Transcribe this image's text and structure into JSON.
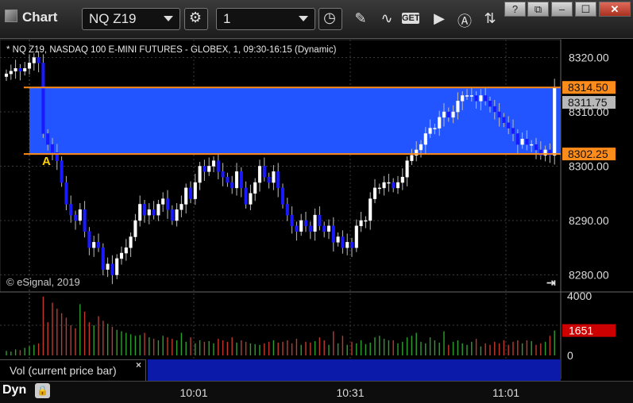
{
  "window": {
    "title": "Chart",
    "symbol": "NQ Z19",
    "interval": "1",
    "toolbar_icons": [
      "settings-gear-icon",
      "clock-icon",
      "pencil-icon",
      "study-icon",
      "get-icon",
      "play-icon",
      "alert-icon",
      "sync-icon"
    ],
    "window_controls": [
      "help-icon",
      "restore-icon",
      "minimize-icon",
      "maximize-icon",
      "close-icon"
    ],
    "help_label": "?",
    "get_label": "GET"
  },
  "chart": {
    "description": "* NQ Z19, NASDAQ 100 E-MINI FUTURES - GLOBEX, 1, 09:30-16:15 (Dynamic)",
    "copyright": "© eSignal, 2019",
    "marker_label": "A",
    "panel_label": "Vol (current price bar)",
    "bottom_mode": "Dyn",
    "colors": {
      "band": "#2255ff",
      "levels": "#ff8c1a",
      "up": "#ffffff",
      "down": "#1a1aff",
      "vol_up": "#2ca02c",
      "vol_down": "#c0392b",
      "vol_label": "#cc0000"
    }
  },
  "chart_data": {
    "type": "candlestick",
    "price_axis": {
      "ylim": [
        8277,
        8323
      ],
      "ticks": [
        "8320.00",
        "8310.00",
        "8300.00",
        "8290.00",
        "8280.00"
      ]
    },
    "volume_axis": {
      "ylim": [
        0,
        4000
      ],
      "ticks": [
        "4000",
        "0"
      ]
    },
    "time_ticks": [
      "10:01",
      "10:31",
      "11:01"
    ],
    "levels": [
      {
        "label": "8314.50",
        "value": 8314.5,
        "style": "orange"
      },
      {
        "label": "8311.75",
        "value": 8311.75,
        "style": "gray"
      },
      {
        "label": "8302.25",
        "value": 8302.25,
        "style": "orange"
      }
    ],
    "band": [
      8302.25,
      8314.5
    ],
    "volume_label": {
      "label": "1651",
      "value": 1651
    },
    "closes": [
      8317,
      8317.5,
      8318,
      8317.5,
      8318,
      8319,
      8320,
      8319,
      8306,
      8304,
      8302.5,
      8301,
      8297,
      8293,
      8291,
      8290,
      8292,
      8288,
      8285,
      8286,
      8285,
      8281,
      8282,
      8280,
      8283,
      8284,
      8285,
      8287,
      8290,
      8293,
      8291,
      8292,
      8291,
      8293,
      8294,
      8292,
      8290,
      8292,
      8293,
      8296,
      8294,
      8297,
      8300,
      8299,
      8300,
      8301,
      8299,
      8298,
      8297,
      8296,
      8299,
      8296,
      8293,
      8295,
      8297,
      8300,
      8298,
      8297,
      8299,
      8296,
      8293,
      8291,
      8289,
      8288,
      8290,
      8289,
      8288,
      8291,
      8289,
      8288,
      8289,
      8286,
      8287,
      8285,
      8286,
      8285,
      8289,
      8290,
      8290,
      8294,
      8296,
      8296,
      8297,
      8297,
      8296,
      8297,
      8298,
      8301,
      8302,
      8303,
      8304,
      8306,
      8307,
      8307,
      8309,
      8310,
      8309,
      8310,
      8312,
      8313,
      8313,
      8313,
      8312,
      8313,
      8312,
      8311,
      8310,
      8309,
      8308,
      8307,
      8306,
      8304,
      8305,
      8304,
      8304,
      8303,
      8302,
      8303,
      8302,
      8314.5
    ],
    "volumes": [
      300,
      250,
      400,
      350,
      500,
      600,
      700,
      800,
      3900,
      2200,
      3500,
      3100,
      2800,
      2500,
      2000,
      1800,
      3400,
      2900,
      2200,
      2000,
      2600,
      2300,
      2100,
      1900,
      1700,
      1600,
      1500,
      1400,
      1300,
      1350,
      1500,
      1200,
      1100,
      1000,
      1300,
      1200,
      1100,
      1000,
      1500,
      900,
      1200,
      800,
      1000,
      900,
      950,
      800,
      1100,
      1000,
      900,
      1200,
      850,
      1000,
      900,
      800,
      750,
      700,
      800,
      900,
      1000,
      850,
      900,
      1000,
      800,
      1100,
      700,
      900,
      850,
      950,
      1200,
      1000,
      700,
      1600,
      800,
      1300,
      700,
      900,
      800,
      1000,
      750,
      850,
      1200,
      1300,
      1100,
      1000,
      1000,
      800,
      900,
      1200,
      1300,
      1500,
      900,
      800,
      1200,
      1000,
      850,
      1600,
      700,
      900,
      1000,
      800,
      700,
      900,
      1100,
      600,
      800,
      700,
      900,
      800,
      1000,
      700,
      900,
      1000,
      800,
      1000,
      950,
      700,
      800,
      900,
      1300,
      1651
    ]
  }
}
